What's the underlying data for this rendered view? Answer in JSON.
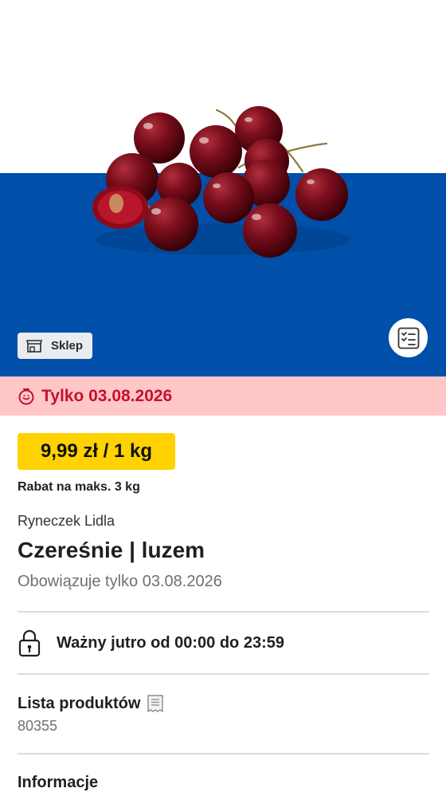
{
  "hero": {
    "image_subject": "cherries",
    "band_color": "#0050aa",
    "store_badge_label": "Sklep",
    "store_icon": "store-icon",
    "list_button_icon": "checklist-icon"
  },
  "alert": {
    "icon": "timer-icon",
    "text": "Tylko 03.08.2026",
    "background": "#ffc7c7",
    "color": "#c8102e"
  },
  "price": {
    "label": "9,99 zł / 1 kg",
    "background": "#ffd200"
  },
  "discount_note": "Rabat na maks. 3 kg",
  "product": {
    "brand": "Ryneczek Lidla",
    "title": "Czereśnie | luzem",
    "validity": "Obowiązuje tylko 03.08.2026"
  },
  "availability": {
    "icon": "lock-icon",
    "text": "Ważny jutro od 00:00 do 23:59"
  },
  "product_list": {
    "title": "Lista produktów",
    "icon": "receipt-icon",
    "number": "80355"
  },
  "info": {
    "title": "Informacje"
  }
}
